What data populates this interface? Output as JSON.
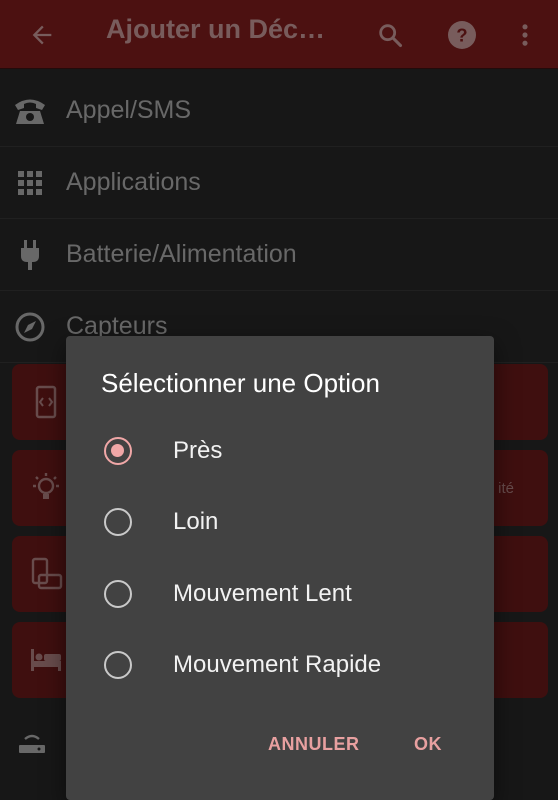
{
  "app_bar": {
    "title": "Ajouter un Déc…",
    "back_icon": "arrow-left-icon",
    "search_icon": "search-icon",
    "help_icon": "help-circle-icon",
    "more_icon": "more-vert-icon",
    "background": "#5a1414"
  },
  "list": {
    "items": [
      {
        "label": "Appel/SMS",
        "icon": "telephone-icon"
      },
      {
        "label": "Applications",
        "icon": "grid-icon"
      },
      {
        "label": "Batterie/Alimentation",
        "icon": "plug-icon"
      },
      {
        "label": "Capteurs",
        "icon": "compass-icon"
      }
    ]
  },
  "cards": {
    "peek_text": "ité"
  },
  "dialog": {
    "title": "Sélectionner une Option",
    "options": [
      {
        "label": "Près",
        "selected": true
      },
      {
        "label": "Loin",
        "selected": false
      },
      {
        "label": "Mouvement Lent",
        "selected": false
      },
      {
        "label": "Mouvement Rapide",
        "selected": false
      }
    ],
    "cancel_label": "ANNULER",
    "ok_label": "OK",
    "accent": "#f0a7a7"
  }
}
